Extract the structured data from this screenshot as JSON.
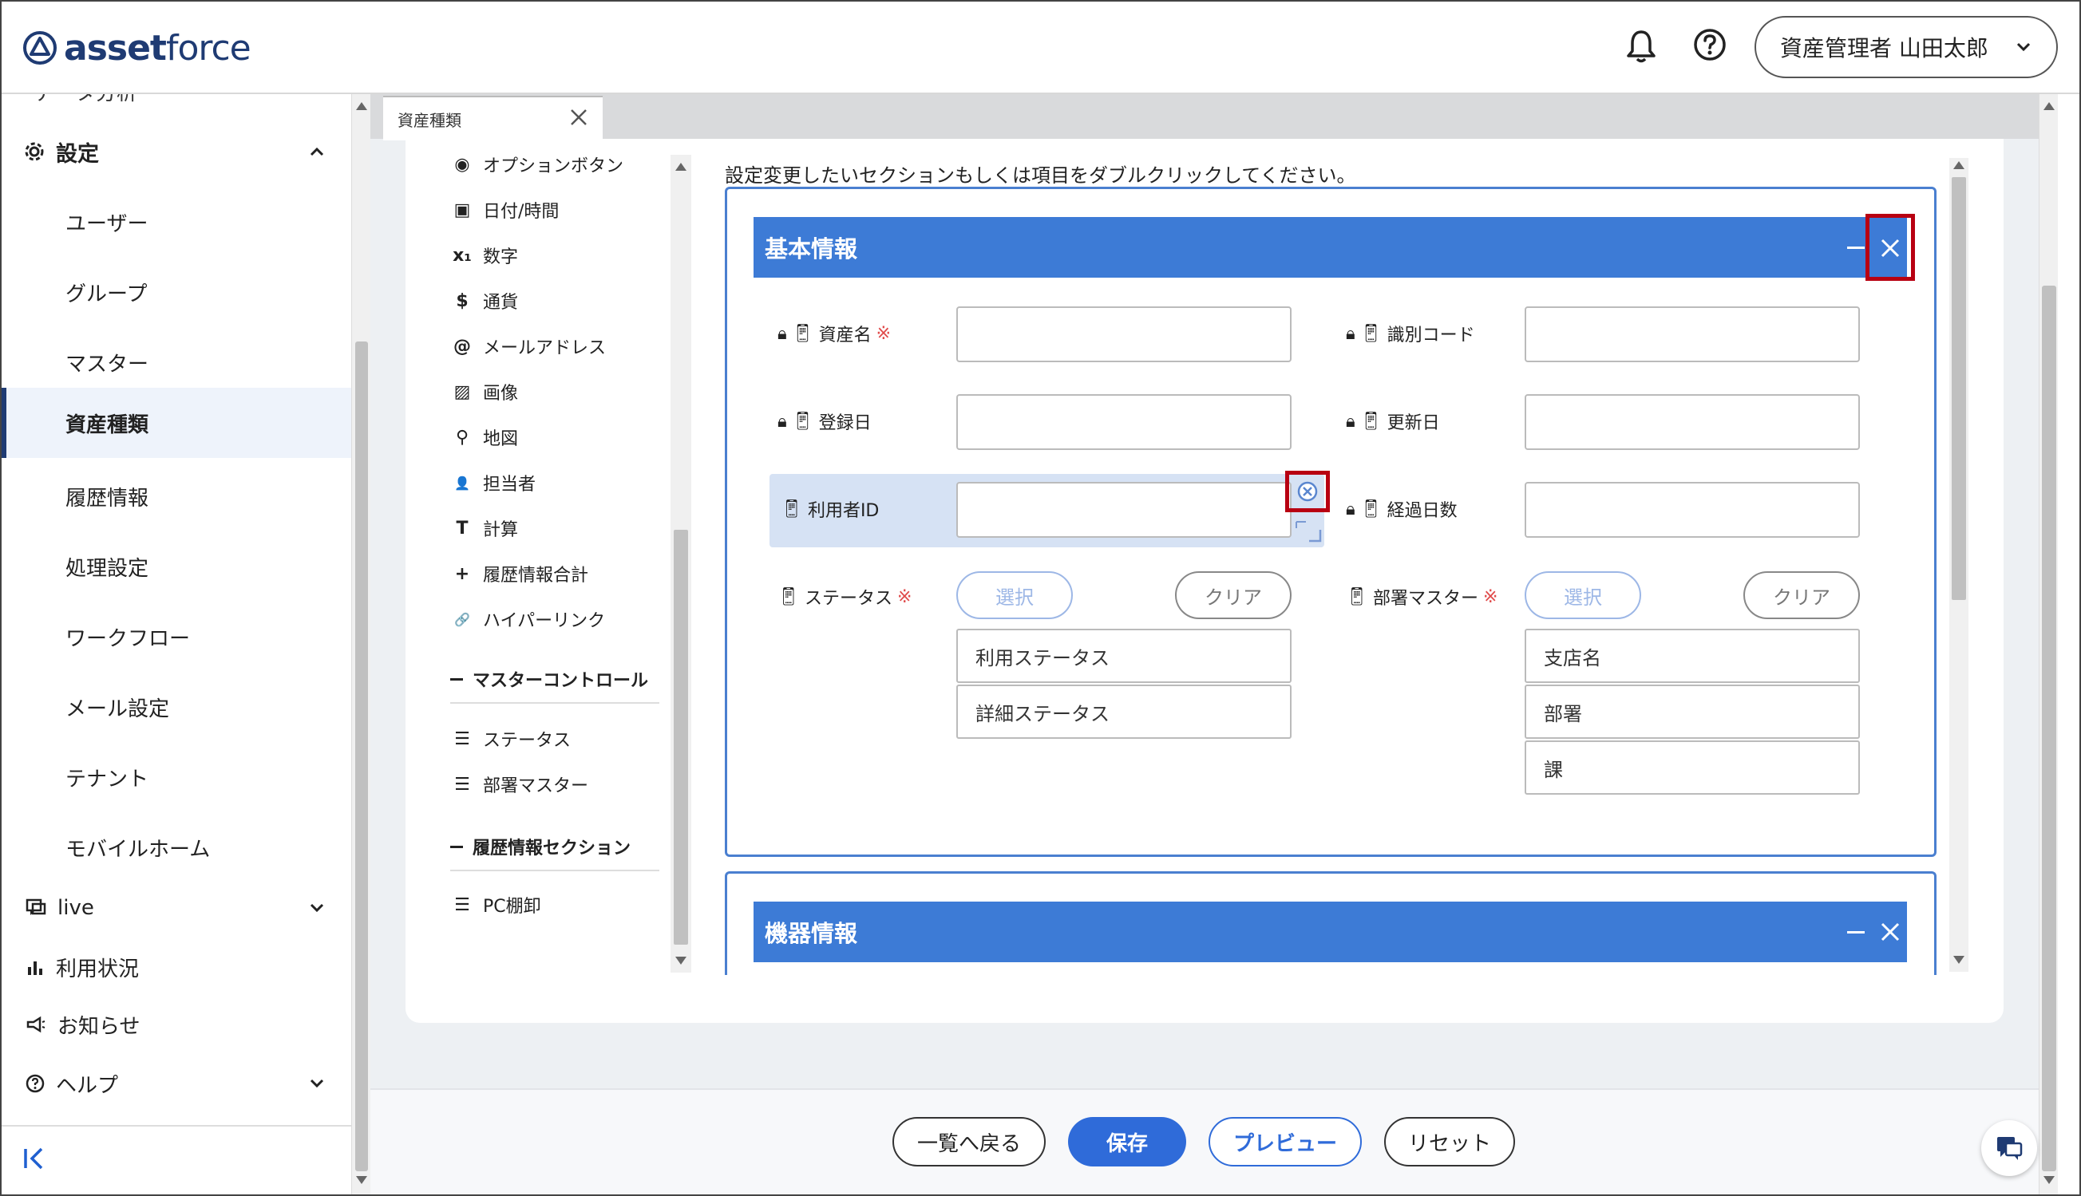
{
  "header": {
    "logo_bold": "asset",
    "logo_light": "force",
    "user_label": "資産管理者 山田太郎"
  },
  "sidebar": {
    "cut_item": "データ分析",
    "settings_label": "設定",
    "items": [
      "ユーザー",
      "グループ",
      "マスター",
      "資産種類",
      "履歴情報",
      "処理設定",
      "ワークフロー",
      "メール設定",
      "テナント",
      "モバイルホーム"
    ],
    "active_index": 3,
    "bottom": {
      "live": "live",
      "usage": "利用状況",
      "notice": "お知らせ",
      "help": "ヘルプ"
    }
  },
  "tab": {
    "label": "資産種類"
  },
  "palette": {
    "items": [
      {
        "icon": "◉",
        "label": "オプションボタン"
      },
      {
        "icon": "▣",
        "label": "日付/時間"
      },
      {
        "icon": "x₁",
        "label": "数字"
      },
      {
        "icon": "$",
        "label": "通貨"
      },
      {
        "icon": "@",
        "label": "メールアドレス"
      },
      {
        "icon": "▨",
        "label": "画像"
      },
      {
        "icon": "⚲",
        "label": "地図"
      },
      {
        "icon": "👤",
        "label": "担当者"
      },
      {
        "icon": "T",
        "label": "計算"
      },
      {
        "icon": "+",
        "label": "履歴情報合計"
      },
      {
        "icon": "🔗",
        "label": "ハイパーリンク"
      }
    ],
    "master_control_label": "マスターコントロール",
    "master_items": [
      "ステータス",
      "部署マスター"
    ],
    "history_section_label": "履歴情報セクション",
    "history_items": [
      "PC棚卸"
    ]
  },
  "instruction": "設定変更したいセクションもしくは項目をダブルクリックしてください。",
  "section1": {
    "title": "基本情報",
    "fields": {
      "asset_name": "資産名",
      "id_code": "識別コード",
      "reg_date": "登録日",
      "upd_date": "更新日",
      "user_id": "利用者ID",
      "elapsed_days": "経過日数",
      "status": "ステータス",
      "dept_master": "部署マスター"
    },
    "required_mark": "※",
    "select_label": "選択",
    "clear_label": "クリア",
    "status_options": [
      "利用ステータス",
      "詳細ステータス"
    ],
    "dept_options": [
      "支店名",
      "部署",
      "課"
    ]
  },
  "section2": {
    "title": "機器情報"
  },
  "footer": {
    "back": "一覧へ戻る",
    "save": "保存",
    "preview": "プレビュー",
    "reset": "リセット"
  },
  "colors": {
    "accent": "#3d7bd6",
    "highlight_frame": "#b80012",
    "brand": "#1f3b73"
  }
}
